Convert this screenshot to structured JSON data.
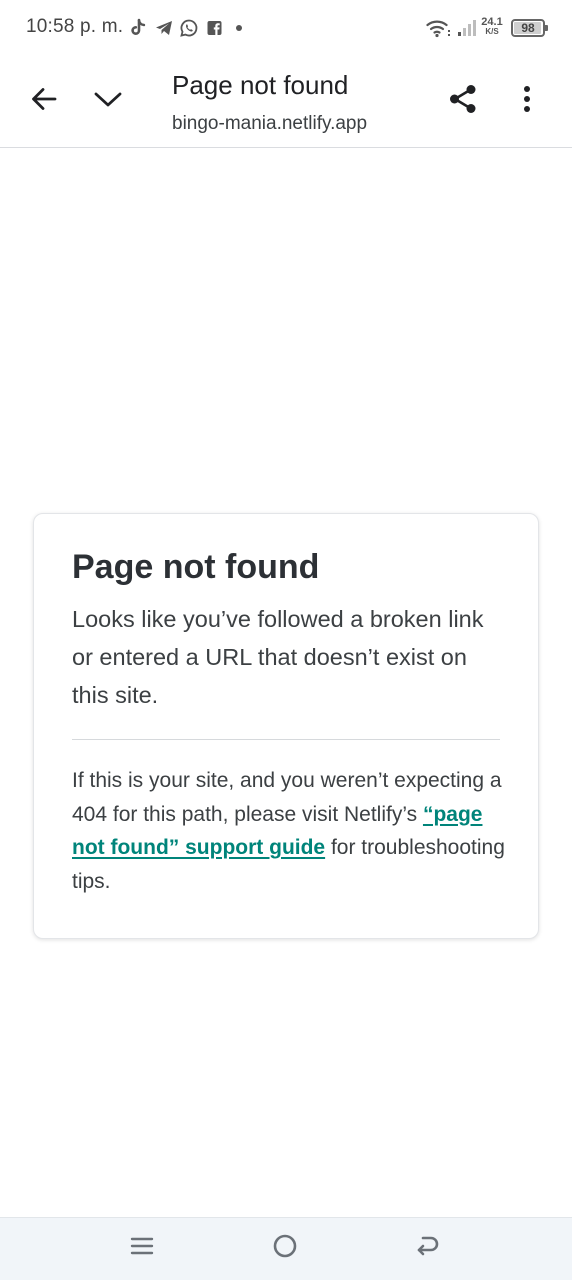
{
  "status_bar": {
    "time": "10:58 p. m.",
    "notification_icons": [
      "tiktok-icon",
      "telegram-icon",
      "whatsapp-icon",
      "facebook-icon",
      "more-notifications-dot"
    ],
    "network_speed_value": "24.1",
    "network_speed_unit": "K/S",
    "battery_level": "98",
    "battery_fraction": 0.98
  },
  "toolbar": {
    "title": "Page not found",
    "url": "bingo-mania.netlify.app",
    "icons": [
      "back-arrow-icon",
      "chevron-down-icon",
      "share-icon",
      "more-vert-icon"
    ]
  },
  "card": {
    "title": "Page not found",
    "description": "Looks like you’ve followed a broken link or entered a URL that doesn’t exist on this site.",
    "help_prefix": "If this is your site, and you weren’t expecting a 404 for this path, please visit Netlify’s ",
    "help_link_text": "“page not found” support guide",
    "help_suffix": " for troubleshooting tips.",
    "link_color": "#00847a"
  },
  "nav_bar": {
    "icons": [
      "menu-lines-icon",
      "home-circle-icon",
      "back-nav-icon"
    ]
  }
}
